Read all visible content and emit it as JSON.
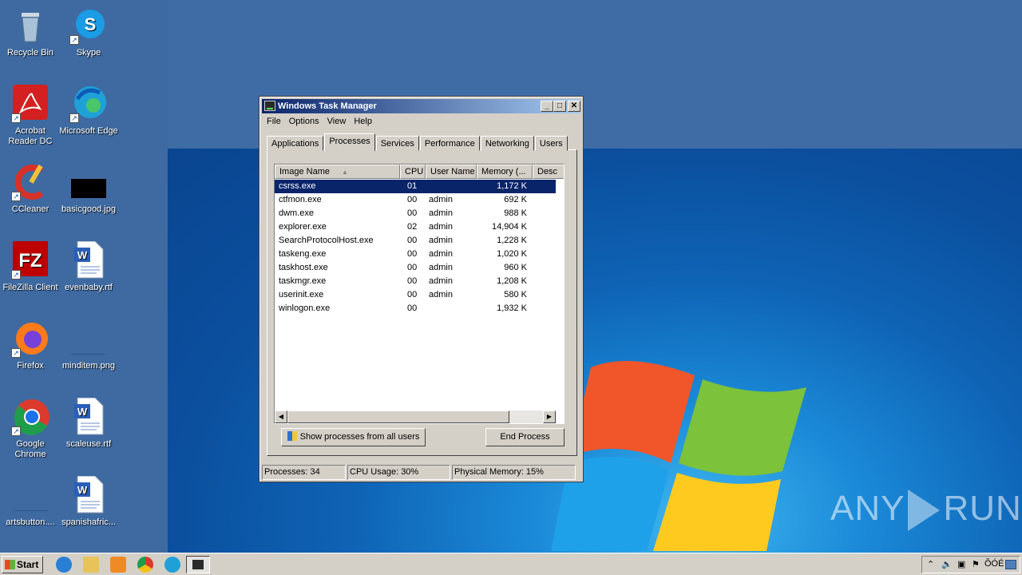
{
  "desktop_icons": [
    {
      "label": "Recycle Bin"
    },
    {
      "label": "Skype"
    },
    {
      "label": "Acrobat Reader DC"
    },
    {
      "label": "Microsoft Edge"
    },
    {
      "label": "CCleaner"
    },
    {
      "label": "basicgood.jpg"
    },
    {
      "label": "FileZilla Client"
    },
    {
      "label": "evenbaby.rtf"
    },
    {
      "label": "Firefox"
    },
    {
      "label": "minditem.png"
    },
    {
      "label": "Google Chrome"
    },
    {
      "label": "scaleuse.rtf"
    },
    {
      "label": "artsbutton...."
    },
    {
      "label": "spanishafric..."
    }
  ],
  "window": {
    "title": "Windows Task Manager",
    "controls": {
      "minimize": "_",
      "maximize": "□",
      "close": "✕"
    },
    "menu": [
      "File",
      "Options",
      "View",
      "Help"
    ],
    "tabs": [
      "Applications",
      "Processes",
      "Services",
      "Performance",
      "Networking",
      "Users"
    ],
    "active_tab": "Processes",
    "columns": [
      "Image Name",
      "CPU",
      "User Name",
      "Memory (...",
      "Desc"
    ],
    "sort_indicator": "▲",
    "processes": [
      {
        "name": "csrss.exe",
        "cpu": "01",
        "user": "",
        "memory": "1,172 K"
      },
      {
        "name": "ctfmon.exe",
        "cpu": "00",
        "user": "admin",
        "memory": "692 K"
      },
      {
        "name": "dwm.exe",
        "cpu": "00",
        "user": "admin",
        "memory": "988 K"
      },
      {
        "name": "explorer.exe",
        "cpu": "02",
        "user": "admin",
        "memory": "14,904 K"
      },
      {
        "name": "SearchProtocolHost.exe",
        "cpu": "00",
        "user": "admin",
        "memory": "1,228 K"
      },
      {
        "name": "taskeng.exe",
        "cpu": "00",
        "user": "admin",
        "memory": "1,020 K"
      },
      {
        "name": "taskhost.exe",
        "cpu": "00",
        "user": "admin",
        "memory": "960 K"
      },
      {
        "name": "taskmgr.exe",
        "cpu": "00",
        "user": "admin",
        "memory": "1,208 K"
      },
      {
        "name": "userinit.exe",
        "cpu": "00",
        "user": "admin",
        "memory": "580 K"
      },
      {
        "name": "winlogon.exe",
        "cpu": "00",
        "user": "",
        "memory": "1,932 K"
      }
    ],
    "show_all_button": "Show processes from all users",
    "end_process_button": "End Process",
    "status": {
      "processes": "Processes: 34",
      "cpu": "CPU Usage: 30%",
      "memory": "Physical Memory: 15%"
    }
  },
  "taskbar": {
    "start_label": "Start",
    "clock": "ÕÓÉ",
    "tray_icons": [
      "chevron-up-icon",
      "speaker-icon",
      "network-icon",
      "flag-icon",
      "show-desktop-icon"
    ]
  },
  "watermark": "ANY RUN",
  "colors": {
    "selection": "#0a246a",
    "title_start": "#0a246a",
    "title_end": "#a6caf0",
    "desktop": "#3e6aa1"
  }
}
